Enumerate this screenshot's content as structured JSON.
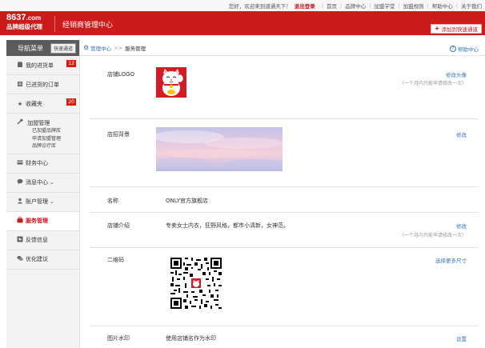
{
  "topbar": {
    "welcome": "您好，欢迎来到道通天下！",
    "logout": "退出登录",
    "links": [
      "首页",
      "品牌中心",
      "加盟学堂",
      "加盟规则",
      "帮助中心",
      "关于我们"
    ]
  },
  "header": {
    "logo_number": "8637",
    "logo_domain": ".com",
    "logo_slogan": "品牌超级代理",
    "title": "经销商管理中心",
    "add_shortcut": "添加到快速通道"
  },
  "sidebar": {
    "title": "导航菜单",
    "quick": "快速通道",
    "items": [
      {
        "label": "我的进货单",
        "icon": "cart-icon",
        "badge": "12"
      },
      {
        "label": "已进货的订单",
        "icon": "list-icon"
      },
      {
        "label": "收藏夹",
        "icon": "star-icon",
        "badge": "20"
      },
      {
        "label": "加盟管理",
        "icon": "wrench-icon",
        "subitems": [
          "已加盟品牌库",
          "申请加盟管理",
          "品牌诊疗库"
        ]
      },
      {
        "label": "财务中心",
        "icon": "card-icon"
      },
      {
        "label": "消息中心",
        "icon": "chat-icon",
        "chevron": "⌄"
      },
      {
        "label": "账户管理",
        "icon": "user-icon",
        "chevron": "⌄"
      },
      {
        "label": "服务管理",
        "icon": "briefcase-icon",
        "active": true
      },
      {
        "label": "反馈信息",
        "icon": "reply-icon"
      },
      {
        "label": "优化建议",
        "icon": "bubble-icon"
      }
    ]
  },
  "breadcrumb": {
    "root": "管理中心",
    "separator": ">>",
    "current": "服务管理"
  },
  "help_label": "帮助中心",
  "rows": {
    "logo": {
      "label": "店铺LOGO",
      "action": "修改头像",
      "note": "（一个月内只能申请修改一次）"
    },
    "banner": {
      "label": "店招背景",
      "action": "修改"
    },
    "name": {
      "label": "名称",
      "value": "ONLY官方旗舰店"
    },
    "intro": {
      "label": "店铺介绍",
      "value": "专卖女士内衣，狂野风格，都市小清新，女神范。",
      "action": "修改",
      "note": "（一个月内只能申请修改一次）"
    },
    "qrcode": {
      "label": "二维码",
      "action": "选择更多尺寸"
    },
    "watermark": {
      "label": "图片水印",
      "value": "使用店铺名作为水印",
      "action": "设置"
    }
  },
  "colors": {
    "brand_red": "#cc1b1b",
    "link_blue": "#3a74b8",
    "sidebar_dark": "#5b5b5b"
  }
}
